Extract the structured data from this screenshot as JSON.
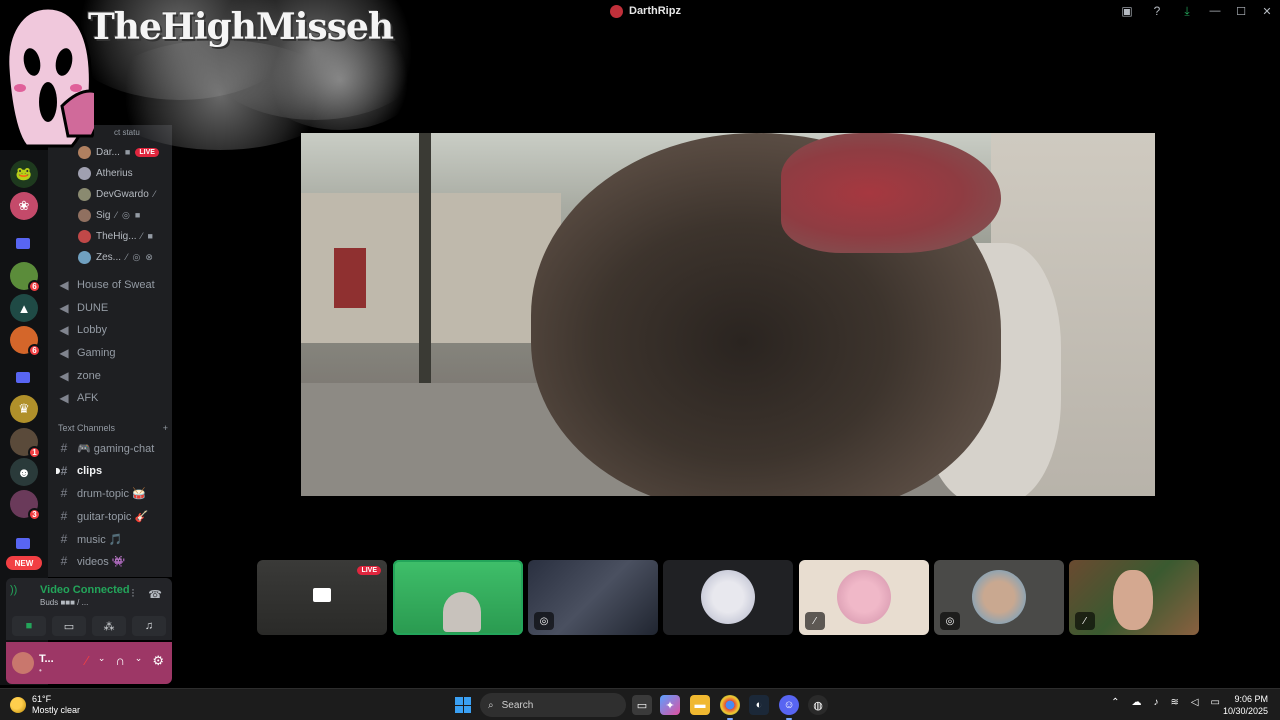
{
  "titlebar": {
    "title": "DarthRipz"
  },
  "overlay": {
    "brand": "TheHighMisseh"
  },
  "server_rail": {
    "badges": [
      "6",
      "6",
      "1",
      "3"
    ],
    "new_label": "NEW"
  },
  "voice_channel": {
    "partial_label": "ct statu",
    "users": [
      {
        "name": "Dar...",
        "live": "LIVE"
      },
      {
        "name": "Atherius"
      },
      {
        "name": "DevGwardo"
      },
      {
        "name": "Sig"
      },
      {
        "name": "TheHig..."
      },
      {
        "name": "Zes..."
      }
    ]
  },
  "voice_channels": [
    "House of Sweat",
    "DUNE",
    "Lobby",
    "Gaming",
    "zone",
    "AFK"
  ],
  "text_category": "Text Channels",
  "text_channels": [
    "🎮 gaming-chat",
    "clips",
    "drum-topic 🥁",
    "guitar-topic 🎸",
    "music 🎵",
    "videos 👾"
  ],
  "voice_panel": {
    "status": "Video Connected",
    "sub": "Buds ■■■ / ..."
  },
  "user_panel": {
    "name": "T...",
    "status": "•"
  },
  "tiles": [
    {
      "live": "LIVE"
    },
    {},
    {},
    {},
    {},
    {},
    {}
  ],
  "taskbar": {
    "temp": "61°F",
    "condition": "Mostly clear",
    "search_placeholder": "Search",
    "time": "9:06 PM",
    "date": "10/30/2025"
  }
}
